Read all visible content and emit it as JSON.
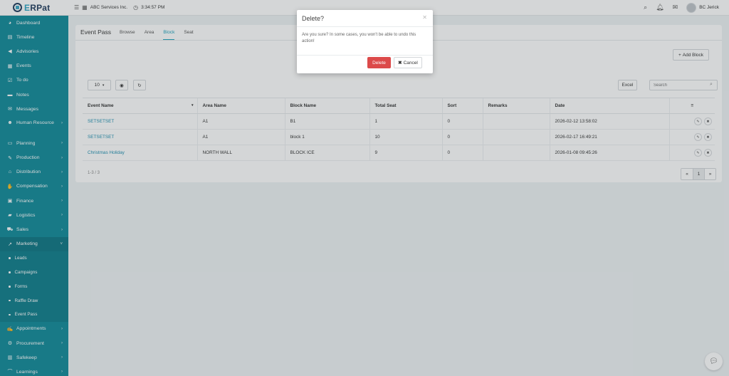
{
  "app": {
    "logo_prefix": "E",
    "logo_text": "RPat",
    "company": "ABC Services Inc.",
    "time": "3:34:57 PM",
    "user": "BC Jerick"
  },
  "sidebar": {
    "items": [
      {
        "label": "Dashboard",
        "icon": "dashboard-icon"
      },
      {
        "label": "Timeline",
        "icon": "timeline-icon"
      },
      {
        "label": "Advisories",
        "icon": "megaphone-icon"
      },
      {
        "label": "Events",
        "icon": "calendar-icon"
      },
      {
        "label": "To do",
        "icon": "checkbox-icon"
      },
      {
        "label": "Notes",
        "icon": "note-icon"
      },
      {
        "label": "Messages",
        "icon": "envelope-icon"
      },
      {
        "label": "Human Resource",
        "icon": "users-icon"
      },
      {
        "label": "Planning",
        "icon": "planning-icon"
      },
      {
        "label": "Production",
        "icon": "production-icon"
      },
      {
        "label": "Distribution",
        "icon": "bank-icon"
      },
      {
        "label": "Compensation",
        "icon": "handshake-icon"
      },
      {
        "label": "Finance",
        "icon": "money-icon"
      },
      {
        "label": "Logistics",
        "icon": "truck-icon"
      },
      {
        "label": "Sales",
        "icon": "cart-icon"
      },
      {
        "label": "Marketing",
        "icon": "chart-icon"
      }
    ],
    "marketing_sub": [
      "Leads",
      "Campaigns",
      "Forms",
      "Raffle Draw",
      "Event Pass"
    ],
    "items_after": [
      {
        "label": "Appointments",
        "icon": "appointment-icon"
      },
      {
        "label": "Procurement",
        "icon": "procurement-icon"
      },
      {
        "label": "Safekeep",
        "icon": "safekeep-icon"
      },
      {
        "label": "Learnings",
        "icon": "graduation-icon"
      }
    ]
  },
  "page": {
    "title": "Event Pass",
    "tabs": [
      "Browse",
      "Area",
      "Block",
      "Seat"
    ],
    "add_button": "Add Block",
    "page_size": "10",
    "excel_button": "Excel",
    "search_placeholder": "Search",
    "columns": [
      "Event Name",
      "Area Name",
      "Block Name",
      "Total Seat",
      "Sort",
      "Remarks",
      "Date",
      "≡"
    ],
    "rows": [
      {
        "event": "SETSETSET",
        "area": "A1",
        "block": "B1",
        "seats": "1",
        "sort": "0",
        "remarks": "",
        "date": "2026-02-12 13:58:02"
      },
      {
        "event": "SETSETSET",
        "area": "A1",
        "block": "block 1",
        "seats": "10",
        "sort": "0",
        "remarks": "",
        "date": "2026-02-17 16:49:21"
      },
      {
        "event": "Christmas Holiday",
        "area": "NORTH WALL",
        "block": "BLOCK ICE",
        "seats": "9",
        "sort": "0",
        "remarks": "",
        "date": "2026-01-08 09:45:26"
      }
    ],
    "count": "1-3 / 3",
    "pager": [
      "«",
      "1",
      "»"
    ]
  },
  "modal": {
    "title": "Delete?",
    "message": "Are you sure? In some cases, you won't be able to undo this action!",
    "delete_label": "Delete",
    "cancel_label": "Cancel"
  },
  "colors": {
    "sidebar": "#0f8a99",
    "accent": "#1ea3bd",
    "danger": "#dc4a4a"
  }
}
